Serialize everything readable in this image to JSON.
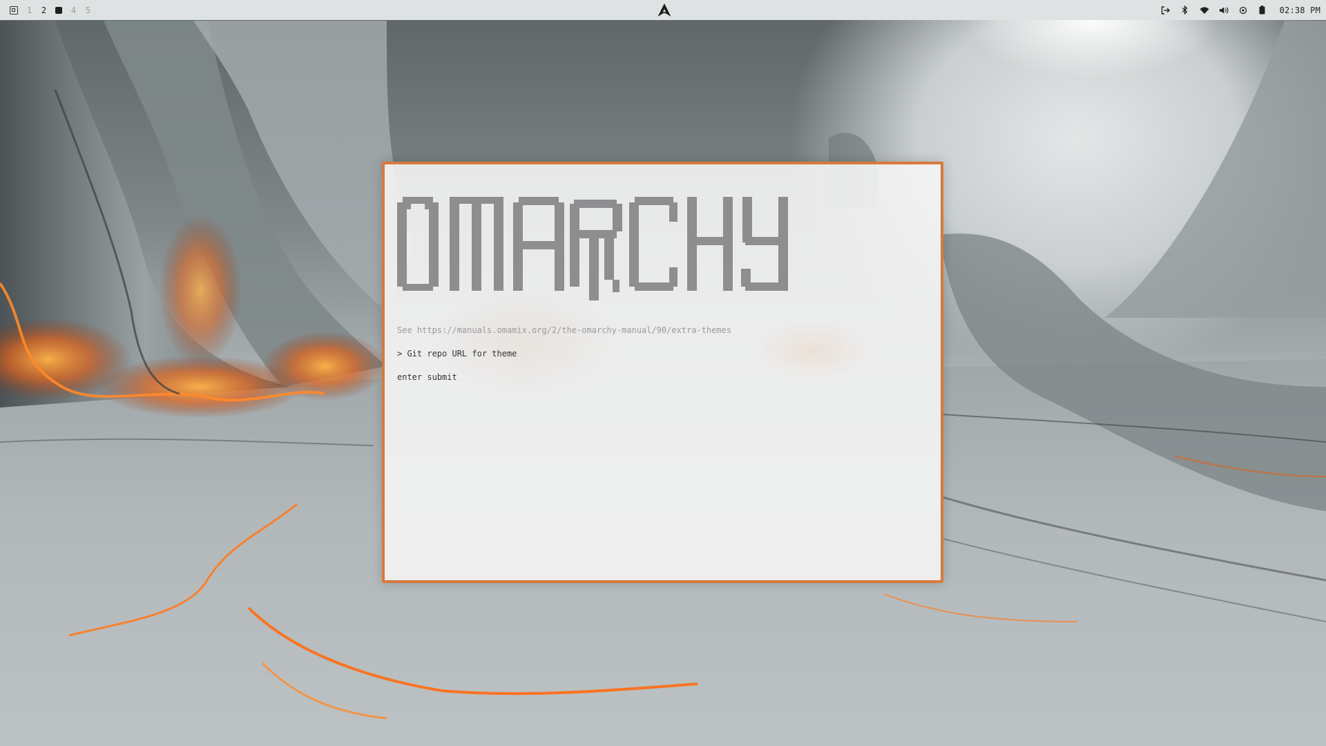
{
  "topbar": {
    "app_icon": "window-layout-icon",
    "workspaces": [
      {
        "label": "1",
        "state": "inactive"
      },
      {
        "label": "2",
        "state": "occupied"
      },
      {
        "label": "",
        "state": "active"
      },
      {
        "label": "4",
        "state": "inactive"
      },
      {
        "label": "5",
        "state": "inactive"
      }
    ],
    "center_icon": "arch-logo-icon",
    "status_icons": [
      "power-icon",
      "bluetooth-icon",
      "wifi-icon",
      "volume-icon",
      "cpu-icon",
      "battery-icon"
    ],
    "clock": "02:38 PM"
  },
  "terminal": {
    "logo_text": "OMARCHY",
    "hint": "See https://manuals.omamix.org/2/the-omarchy-manual/90/extra-themes",
    "prompt": "> Git repo URL for theme",
    "help": "enter submit"
  },
  "colors": {
    "accent": "#d77a3c",
    "logo": "#8e8e90",
    "topbar_bg": "#dfe2e3",
    "window_bg": "#f4f4f4"
  }
}
